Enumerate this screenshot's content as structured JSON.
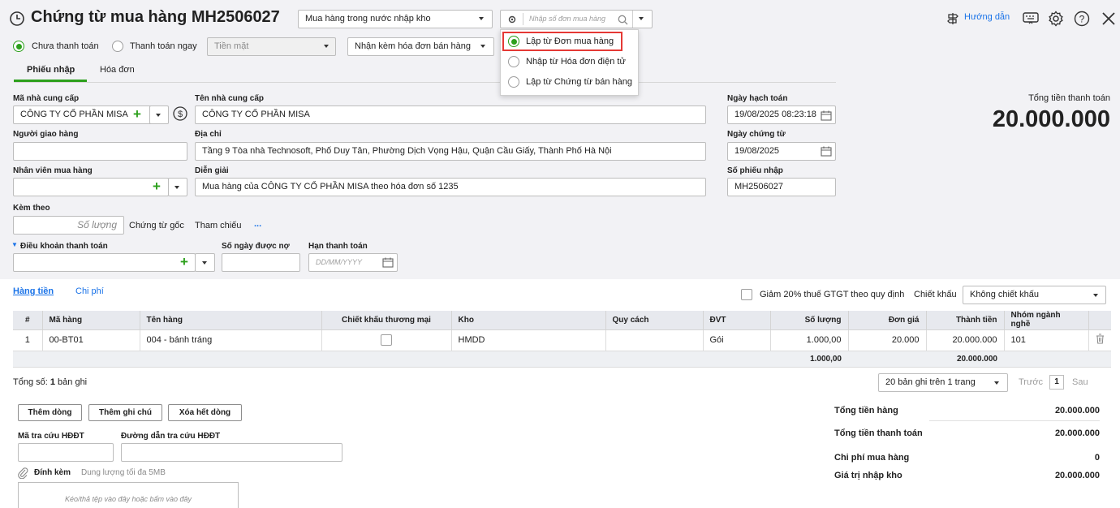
{
  "header": {
    "title": "Chứng từ mua hàng MH2506027",
    "purchase_type": "Mua hàng trong nước nhập kho",
    "search_placeholder": "Nhập số đơn mua hàng",
    "help_label": "Hướng dẫn"
  },
  "payment": {
    "unpaid_label": "Chưa thanh toán",
    "paid_label": "Thanh toán ngay",
    "method": "Tiền mặt",
    "invoice_mode": "Nhận kèm hóa đơn bán hàng"
  },
  "popup": {
    "items": [
      "Lập từ Đơn mua hàng",
      "Nhập từ Hóa đơn điện tử",
      "Lập từ Chứng từ bán hàng"
    ]
  },
  "tabs": [
    "Phiếu nhập",
    "Hóa đơn"
  ],
  "form": {
    "supplier_code_label": "Mã nhà cung cấp",
    "supplier_code": "CÔNG TY CỔ PHẦN MISA",
    "supplier_name_label": "Tên nhà cung cấp",
    "supplier_name": "CÔNG TY CỔ PHẦN MISA",
    "deliverer_label": "Người giao hàng",
    "address_label": "Địa chỉ",
    "address": "Tầng 9 Tòa nhà Technosoft, Phố Duy Tân, Phường Dịch Vọng Hậu, Quận Cầu Giấy, Thành Phố Hà Nội",
    "staff_label": "Nhân viên mua hàng",
    "desc_label": "Diễn giải",
    "desc": "Mua hàng của CÔNG TY CỔ PHẦN MISA theo hóa đơn số 1235",
    "attach_label": "Kèm theo",
    "qty_placeholder": "Số lượng",
    "orig_doc": "Chứng từ gốc",
    "reference": "Tham chiếu",
    "ellipsis": "...",
    "terms_label": "Điều khoản thanh toán",
    "debt_days_label": "Số ngày được nợ",
    "due_label": "Hạn thanh toán",
    "due_placeholder": "DD/MM/YYYY",
    "posting_date_label": "Ngày hạch toán",
    "posting_date": "19/08/2025 08:23:18",
    "doc_date_label": "Ngày chứng từ",
    "doc_date": "19/08/2025",
    "receipt_no_label": "Số phiếu nhập",
    "receipt_no": "MH2506027",
    "total_label": "Tổng tiền thanh toán",
    "total": "20.000.000"
  },
  "detail_tabs": [
    "Hàng tiền",
    "Chi phí"
  ],
  "vat_reduce_label": "Giảm 20% thuế GTGT theo quy định",
  "discount_label": "Chiết khấu",
  "discount_value": "Không chiết khấu",
  "table": {
    "columns": [
      "#",
      "Mã hàng",
      "Tên hàng",
      "Chiết khấu thương mại",
      "Kho",
      "Quy cách",
      "ĐVT",
      "Số lượng",
      "Đơn giá",
      "Thành tiền",
      "Nhóm ngành nghề"
    ],
    "rows": [
      {
        "no": "1",
        "code": "00-BT01",
        "name": "004 - bánh tráng",
        "warehouse": "HMDD",
        "spec": "",
        "unit": "Gói",
        "qty": "1.000,00",
        "price": "20.000",
        "amount": "20.000.000",
        "group": "101"
      }
    ],
    "sum_qty": "1.000,00",
    "sum_amount": "20.000.000"
  },
  "footer": {
    "count_prefix": "Tổng số: ",
    "count_value": "1",
    "count_suffix": " bản ghi",
    "page_size": "20 bản ghi trên 1 trang",
    "prev": "Trước",
    "page": "1",
    "next": "Sau",
    "add_row": "Thêm dòng",
    "add_note": "Thêm ghi chú",
    "delete_all": "Xóa hết dòng",
    "lookup_code_label": "Mã tra cứu HĐĐT",
    "lookup_url_label": "Đường dẫn tra cứu HĐĐT",
    "attach_label": "Đính kèm",
    "attach_limit": "Dung lượng tối đa 5MB",
    "drop_hint": "Kéo/thả tệp vào đây hoặc bấm vào đây"
  },
  "summary": [
    {
      "label": "Tổng tiền hàng",
      "value": "20.000.000"
    },
    {
      "label": "Tổng tiền thanh toán",
      "value": "20.000.000"
    },
    {
      "label": "Chi phí mua hàng",
      "value": "0"
    },
    {
      "label": "Giá trị nhập kho",
      "value": "20.000.000"
    }
  ],
  "colors": {
    "accent": "#2ca01c",
    "link": "#1a73e8",
    "highlight": "#e53935"
  }
}
